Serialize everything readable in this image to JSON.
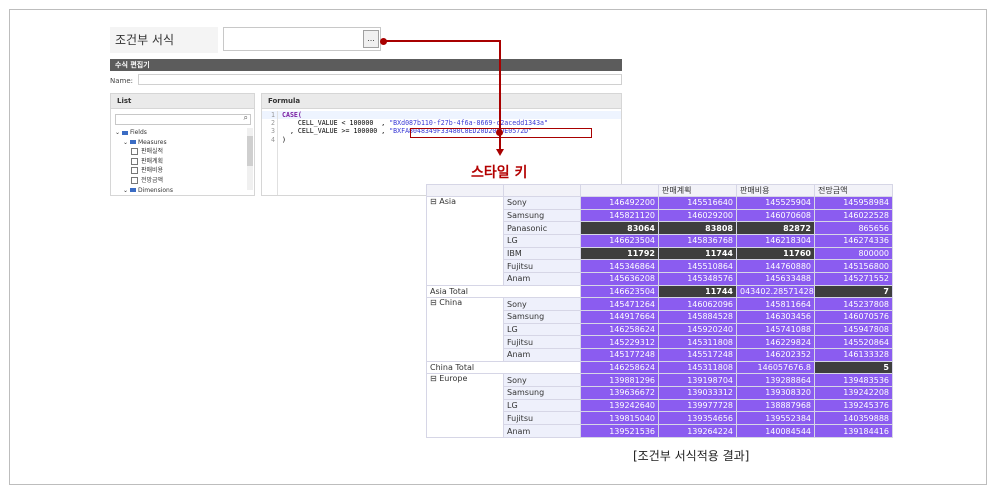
{
  "conditional_format": {
    "label": "조건부 서식",
    "button_label": "..."
  },
  "editor": {
    "title": "수식 편집기",
    "name_label": "Name:",
    "list_header": "List",
    "formula_header": "Formula",
    "tree": [
      {
        "label": "Fields",
        "type": "folder",
        "level": 0
      },
      {
        "label": "Measures",
        "type": "folder",
        "level": 1
      },
      {
        "label": "판매실적",
        "type": "check",
        "level": 2
      },
      {
        "label": "판매계획",
        "type": "check",
        "level": 2
      },
      {
        "label": "판매비용",
        "type": "check",
        "level": 2
      },
      {
        "label": "전망금액",
        "type": "check",
        "level": 2
      },
      {
        "label": "Dimensions",
        "type": "folder",
        "level": 1
      }
    ],
    "line_numbers": [
      "1",
      "2",
      "3",
      "4"
    ],
    "code": {
      "l1_kw": "CASE(",
      "l2_prefix": "    CELL_VALUE < 100000  , ",
      "l2_str": "\"BXd087b110-f27b-4f6a-8669-c2acedd1343a\"",
      "l3_prefix": "  , CELL_VALUE >= 100000 , ",
      "l3_str": "\"BXFA8048349F33480C8ED20D208DE0572D\"",
      "l4": ")"
    }
  },
  "annotation": {
    "style_key_label": "스타일 키"
  },
  "grid": {
    "headers": [
      "판매계획",
      "판매비용",
      "전망금액"
    ],
    "rows": [
      {
        "group": "⊟ Asia",
        "group_rowspan": 7,
        "item": "Sony",
        "values": [
          "146492200",
          "145516640",
          "145525904",
          "145958984"
        ],
        "styles": [
          "v",
          "v",
          "v",
          "v"
        ]
      },
      {
        "item": "Samsung",
        "values": [
          "145821120",
          "146029200",
          "146070608",
          "146022528"
        ],
        "styles": [
          "v",
          "v",
          "v",
          "v"
        ]
      },
      {
        "item": "Panasonic",
        "values": [
          "83064",
          "83808",
          "82872",
          "865656"
        ],
        "styles": [
          "d",
          "d",
          "d",
          "v"
        ]
      },
      {
        "item": "LG",
        "values": [
          "146623504",
          "145836768",
          "146218304",
          "146274336"
        ],
        "styles": [
          "v",
          "v",
          "v",
          "v"
        ]
      },
      {
        "item": "IBM",
        "values": [
          "11792",
          "11744",
          "11760",
          "800000"
        ],
        "styles": [
          "d",
          "d",
          "d",
          "v"
        ]
      },
      {
        "item": "Fujitsu",
        "values": [
          "145346864",
          "145510864",
          "144760880",
          "145156800"
        ],
        "styles": [
          "v",
          "v",
          "v",
          "v"
        ]
      },
      {
        "item": "Anam",
        "values": [
          "145636208",
          "145348576",
          "145633488",
          "145271552"
        ],
        "styles": [
          "v",
          "v",
          "v",
          "v"
        ]
      },
      {
        "total": "Asia Total",
        "values": [
          "146623504",
          "11744",
          "043402.28571428",
          "7"
        ],
        "styles": [
          "v",
          "d",
          "v",
          "d"
        ]
      },
      {
        "group": "⊟ China",
        "group_rowspan": 5,
        "item": "Sony",
        "values": [
          "145471264",
          "146062096",
          "145811664",
          "145237808"
        ],
        "styles": [
          "v",
          "v",
          "v",
          "v"
        ]
      },
      {
        "item": "Samsung",
        "values": [
          "144917664",
          "145884528",
          "146303456",
          "146070576"
        ],
        "styles": [
          "v",
          "v",
          "v",
          "v"
        ]
      },
      {
        "item": "LG",
        "values": [
          "146258624",
          "145920240",
          "145741088",
          "145947808"
        ],
        "styles": [
          "v",
          "v",
          "v",
          "v"
        ]
      },
      {
        "item": "Fujitsu",
        "values": [
          "145229312",
          "145311808",
          "146229824",
          "145520864"
        ],
        "styles": [
          "v",
          "v",
          "v",
          "v"
        ]
      },
      {
        "item": "Anam",
        "values": [
          "145177248",
          "145517248",
          "146202352",
          "146133328"
        ],
        "styles": [
          "v",
          "v",
          "v",
          "v"
        ]
      },
      {
        "total": "China Total",
        "values": [
          "146258624",
          "145311808",
          "146057676.8",
          "5"
        ],
        "styles": [
          "v",
          "v",
          "v",
          "d"
        ]
      },
      {
        "group": "⊟ Europe",
        "group_rowspan": 5,
        "item": "Sony",
        "values": [
          "139881296",
          "139198704",
          "139288864",
          "139483536"
        ],
        "styles": [
          "v",
          "v",
          "v",
          "v"
        ]
      },
      {
        "item": "Samsung",
        "values": [
          "139636672",
          "139033312",
          "139308320",
          "139242208"
        ],
        "styles": [
          "v",
          "v",
          "v",
          "v"
        ]
      },
      {
        "item": "LG",
        "values": [
          "139242640",
          "139977728",
          "138887968",
          "139245376"
        ],
        "styles": [
          "v",
          "v",
          "v",
          "v"
        ]
      },
      {
        "item": "Fujitsu",
        "values": [
          "139815040",
          "139354656",
          "139552384",
          "140359888"
        ],
        "styles": [
          "v",
          "v",
          "v",
          "v"
        ]
      },
      {
        "item": "Anam",
        "values": [
          "139521536",
          "139264224",
          "140084544",
          "139184416"
        ],
        "styles": [
          "v",
          "v",
          "v",
          "v"
        ]
      }
    ]
  },
  "caption": "[조건부 서식적용 결과]",
  "colors": {
    "accent_red": "#a80000",
    "cell_purple": "#8b5cf0",
    "cell_dark": "#3e3e3e"
  }
}
